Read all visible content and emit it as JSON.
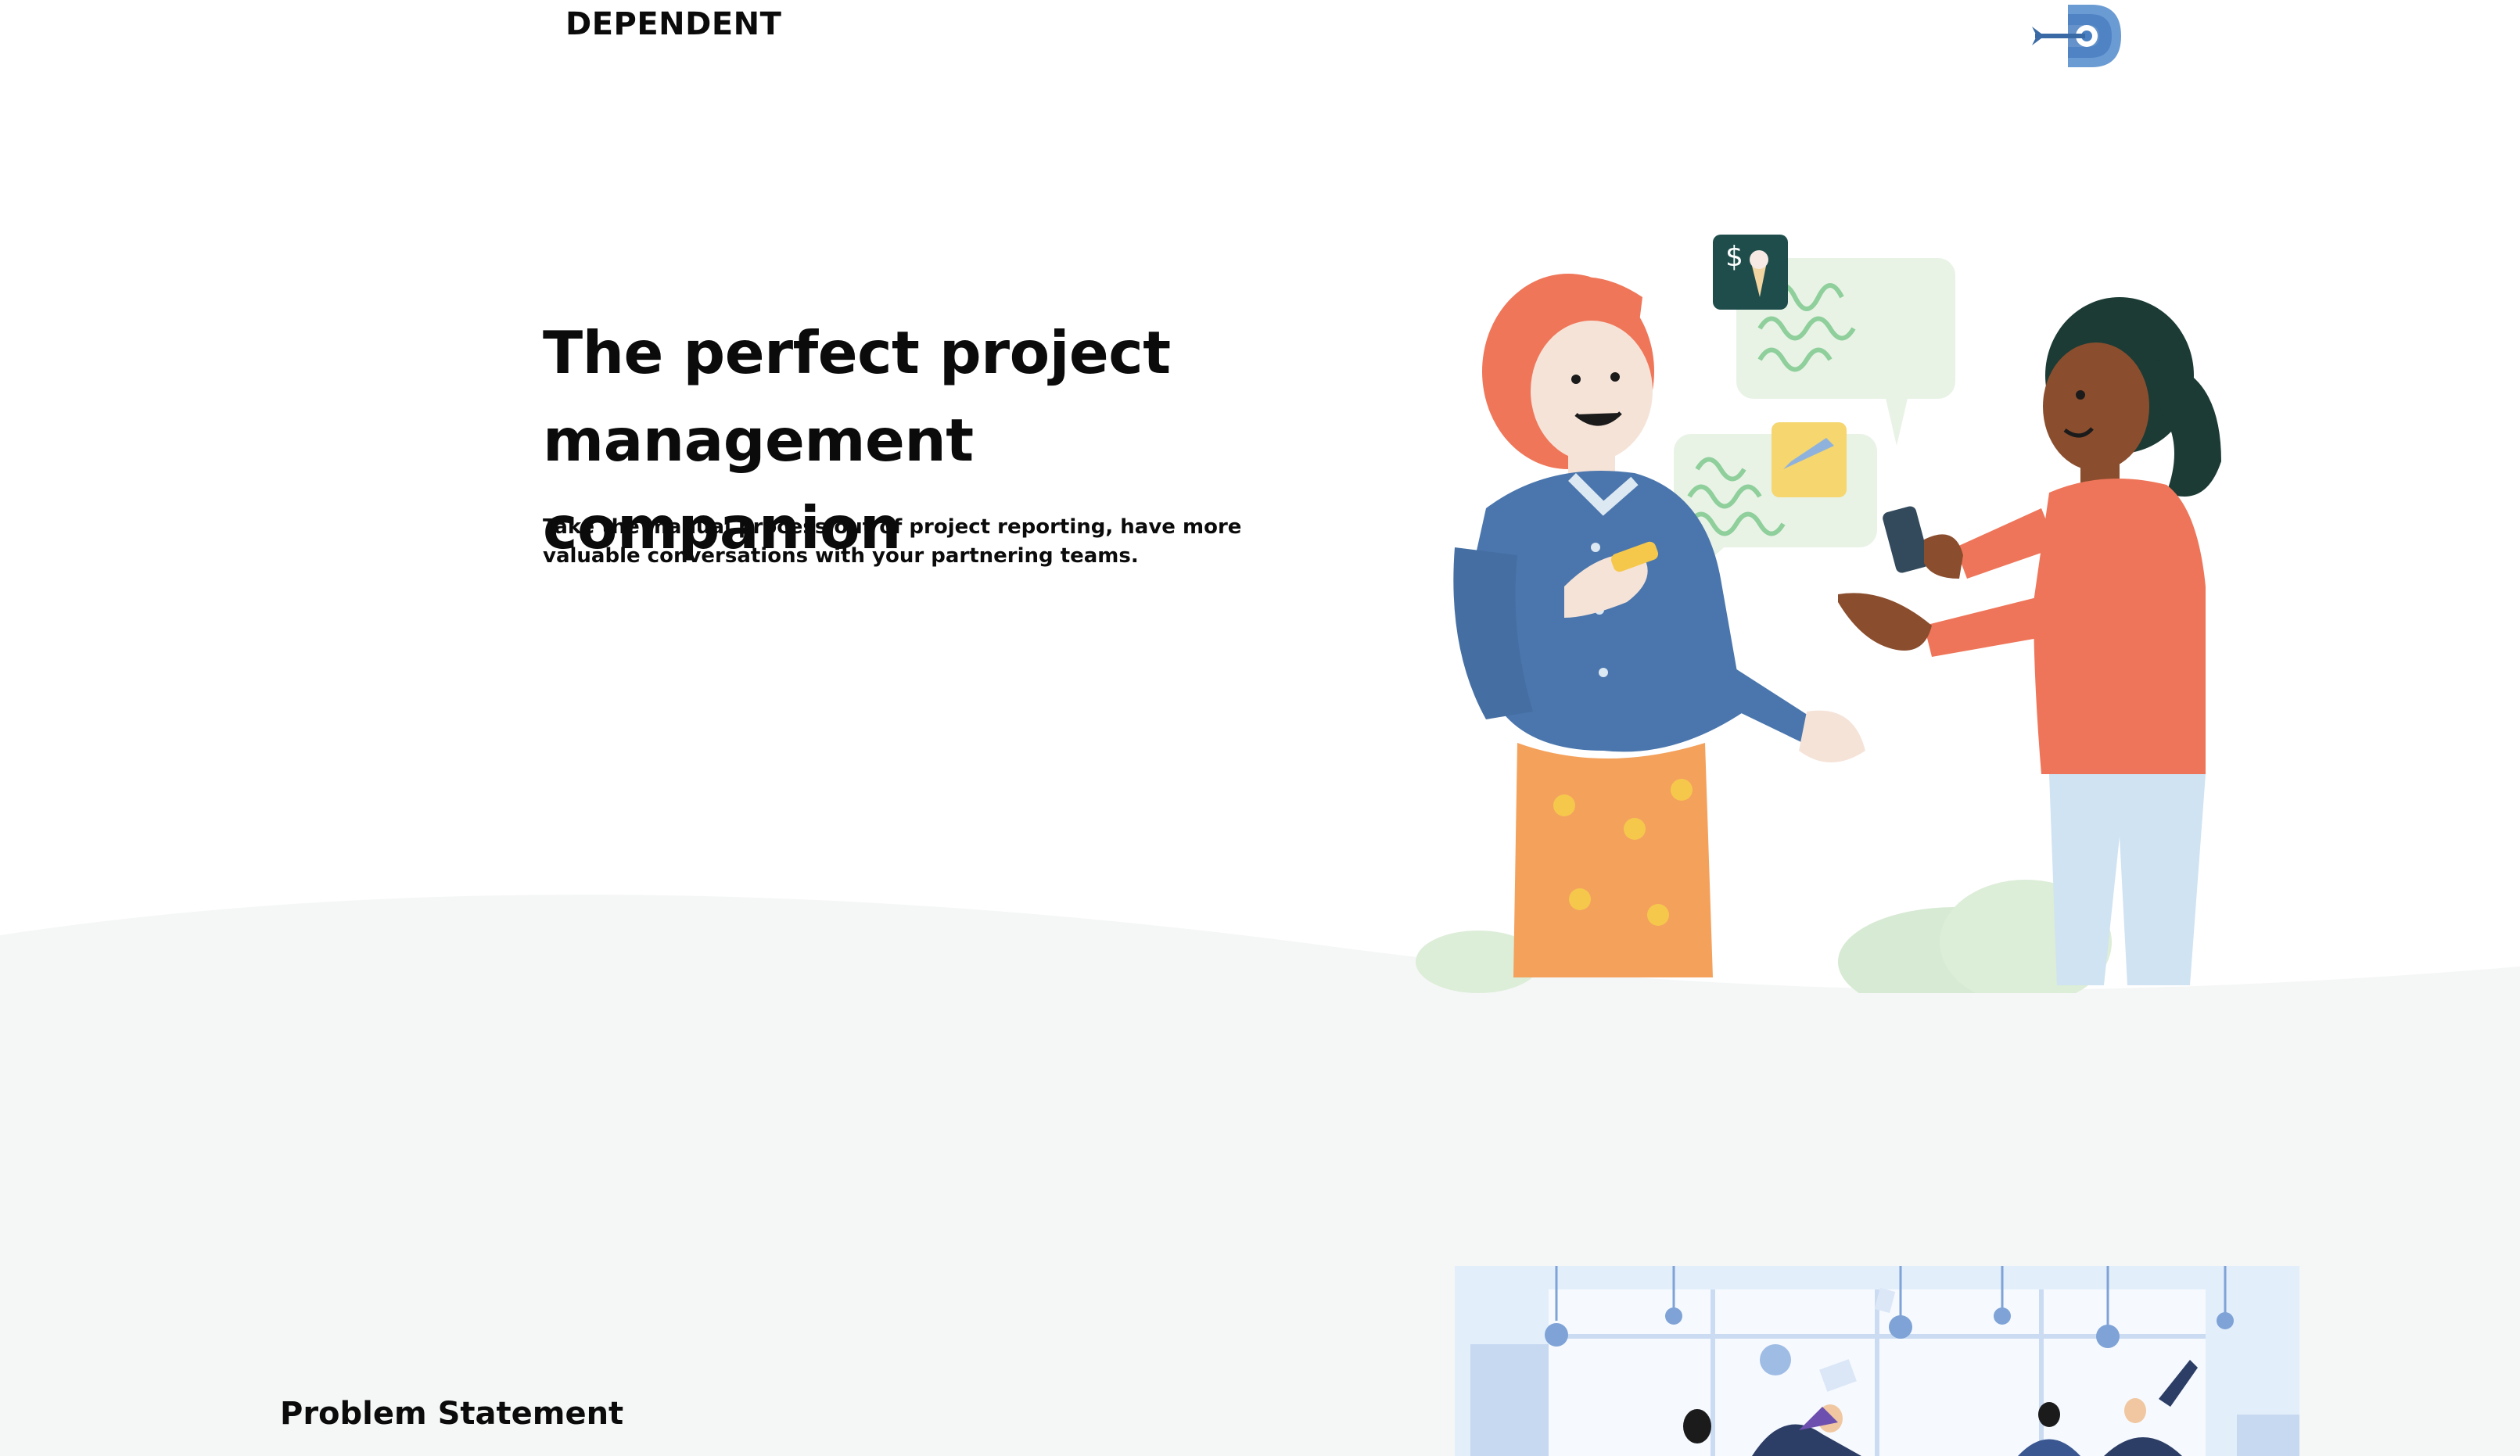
{
  "header": {
    "brand": "DEPENDENT",
    "logo_icon": "dependent-logo-icon"
  },
  "hero": {
    "title": "The perfect project management companion",
    "subtitle": "Take the manual process out of project reporting, have more valuable conversations with your partnering teams.",
    "illustration": "two-people-chatting-illustration"
  },
  "section2": {
    "heading": "Problem Statement",
    "illustration": "office-celebration-illustration"
  },
  "colors": {
    "text": "#0b0b0b",
    "brand_blue": "#4a7fc1",
    "light_bg": "#f5f7f6",
    "orange": "#ee7559",
    "denim": "#4a76ad"
  }
}
